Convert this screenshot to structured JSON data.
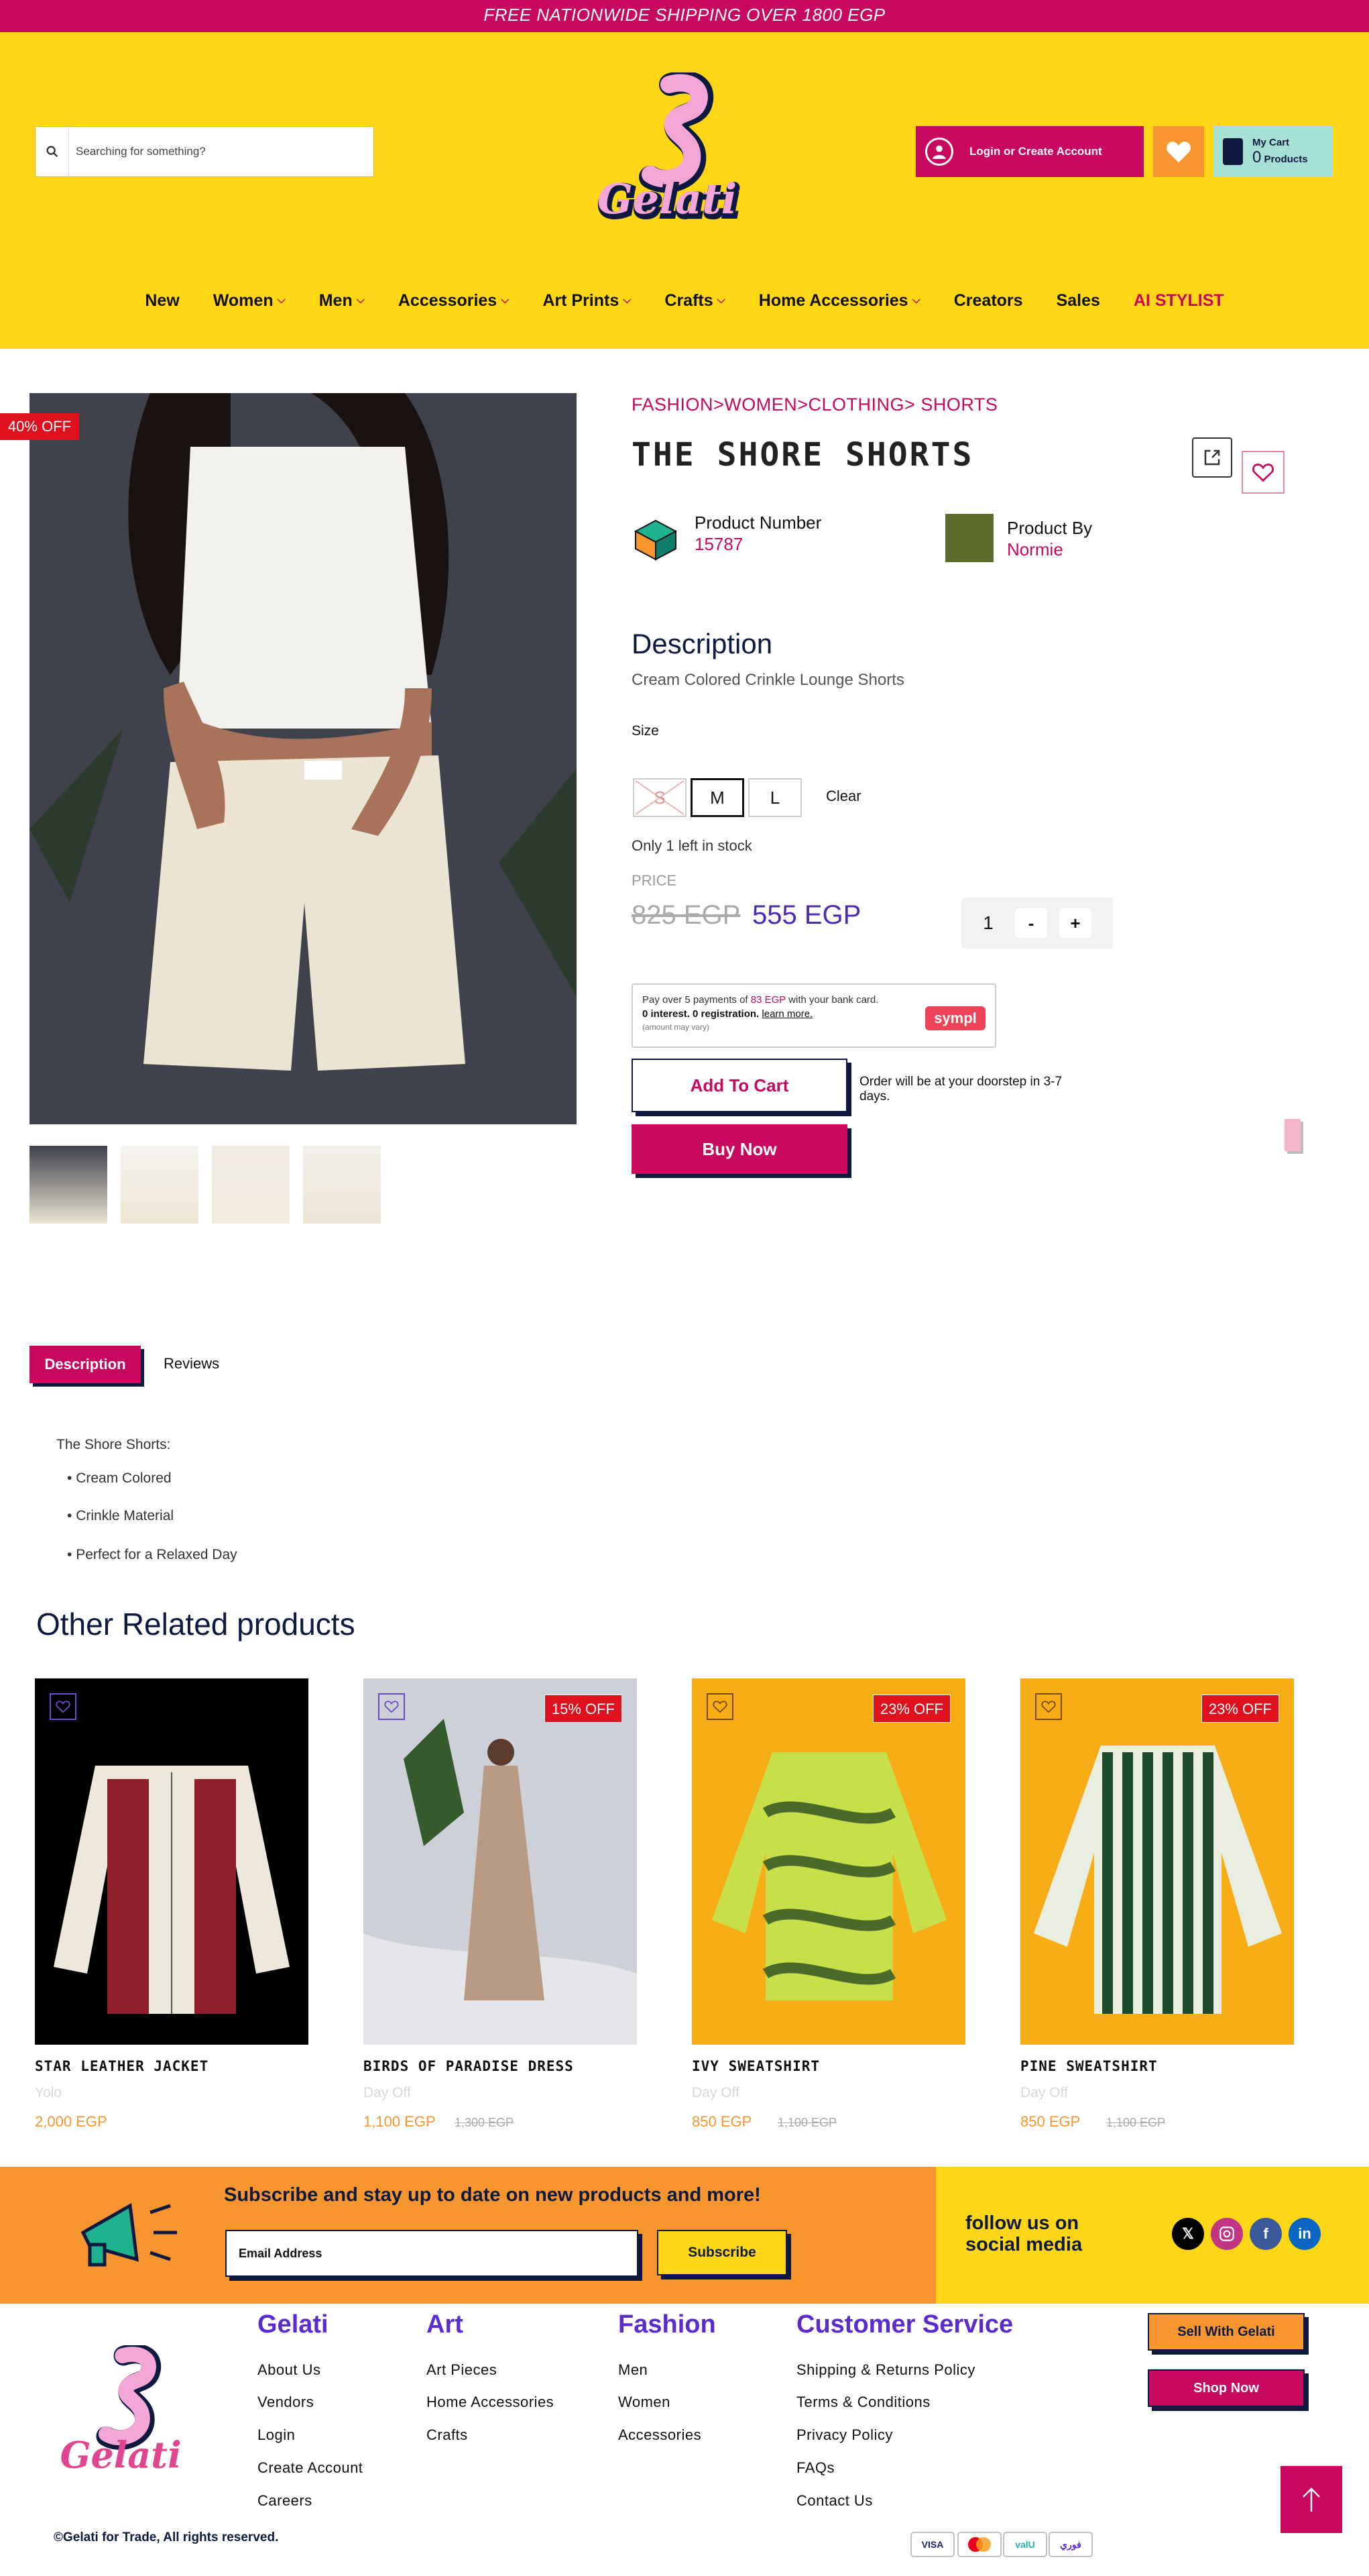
{
  "promo": "FREE NATIONWIDE SHIPPING OVER 1800 EGP",
  "search": {
    "placeholder": "Searching for something?"
  },
  "logo": "Gelati",
  "header": {
    "login": "Login or Create Account",
    "cart_title": "My Cart",
    "cart_count": "0",
    "cart_unit": "Products"
  },
  "nav": [
    {
      "label": "New",
      "dropdown": false
    },
    {
      "label": "Women",
      "dropdown": true
    },
    {
      "label": "Men",
      "dropdown": true
    },
    {
      "label": "Accessories",
      "dropdown": true
    },
    {
      "label": "Art Prints",
      "dropdown": true
    },
    {
      "label": "Crafts",
      "dropdown": true
    },
    {
      "label": "Home Accessories",
      "dropdown": true
    },
    {
      "label": "Creators",
      "dropdown": false
    },
    {
      "label": "Sales",
      "dropdown": false
    },
    {
      "label": "AI STYLIST",
      "dropdown": false
    }
  ],
  "product": {
    "discount_badge": "40% OFF",
    "breadcrumb": "FASHION>WOMEN>CLOTHING> SHORTS",
    "title": "THE SHORE SHORTS",
    "number_label": "Product Number",
    "number_value": "15787",
    "by_label": "Product By",
    "by_value": "Normie",
    "description_title": "Description",
    "description_text": "Cream Colored Crinkle Lounge Shorts",
    "size_label": "Size",
    "sizes": [
      {
        "label": "S",
        "available": false,
        "selected": false
      },
      {
        "label": "M",
        "available": true,
        "selected": true
      },
      {
        "label": "L",
        "available": true,
        "selected": false
      }
    ],
    "clear": "Clear",
    "stock": "Only 1 left in stock",
    "price_label": "PRICE",
    "old_price": "825 EGP",
    "new_price": "555 EGP",
    "quantity": "1",
    "minus": "-",
    "plus": "+",
    "sympl_line1_a": "Pay over 5 payments of ",
    "sympl_line1_b": "83 EGP",
    "sympl_line1_c": " with your bank card.",
    "sympl_line2_a": "0 interest. 0 registration.",
    "sympl_line2_b": "learn more.",
    "sympl_line3": "(amount may vary)",
    "sympl_logo": "sympl",
    "add_to_cart": "Add To Cart",
    "delivery_note": "Order will be at your doorstep in 3-7 days.",
    "buy_now": "Buy Now"
  },
  "tabs": {
    "description": "Description",
    "reviews": "Reviews"
  },
  "details": {
    "heading": "The Shore Shorts:",
    "items": [
      "Cream Colored",
      "Crinkle Material",
      "Perfect for a Relaxed Day"
    ]
  },
  "related": {
    "title": "Other Related products",
    "items": [
      {
        "name": "STAR LEATHER JACKET",
        "vendor": "Yolo",
        "price": "2,000 EGP",
        "old_price": "",
        "badge": ""
      },
      {
        "name": "BIRDS OF PARADISE DRESS",
        "vendor": "Day Off",
        "price": "1,100 EGP",
        "old_price": "1,300 EGP",
        "badge": "15% OFF"
      },
      {
        "name": "IVY SWEATSHIRT",
        "vendor": "Day Off",
        "price": "850 EGP",
        "old_price": "1,100 EGP",
        "badge": "23% OFF"
      },
      {
        "name": "PINE SWEATSHIRT",
        "vendor": "Day Off",
        "price": "850 EGP",
        "old_price": "1,100 EGP",
        "badge": "23% OFF"
      }
    ]
  },
  "subscribe": {
    "title": "Subscribe and stay up to date on new products and more!",
    "email_placeholder": "Email Address",
    "button": "Subscribe",
    "follow": "follow us on social media"
  },
  "social": [
    "x-icon",
    "instagram-icon",
    "facebook-icon",
    "linkedin-icon"
  ],
  "footer": {
    "columns": [
      {
        "title": "Gelati",
        "links": [
          "About Us",
          "Vendors",
          "Login",
          "Create Account",
          "Careers"
        ]
      },
      {
        "title": "Art",
        "links": [
          "Art Pieces",
          "Home Accessories",
          "Crafts"
        ]
      },
      {
        "title": "Fashion",
        "links": [
          "Men",
          "Women",
          "Accessories"
        ]
      },
      {
        "title": "Customer Service",
        "links": [
          "Shipping & Returns Policy",
          "Terms & Conditions",
          "Privacy Policy",
          "FAQs",
          "Contact Us"
        ]
      }
    ],
    "sell": "Sell With Gelati",
    "shop": "Shop Now",
    "copyright": "©Gelati for Trade, All rights reserved.",
    "payments": [
      "VISA",
      "mastercard",
      "valU",
      "فوري"
    ]
  },
  "colors": {
    "brand_pink": "#c8075e",
    "brand_yellow": "#ffd716",
    "orange": "#f79630",
    "navy": "#0e1940",
    "purple": "#5a2bd1"
  }
}
